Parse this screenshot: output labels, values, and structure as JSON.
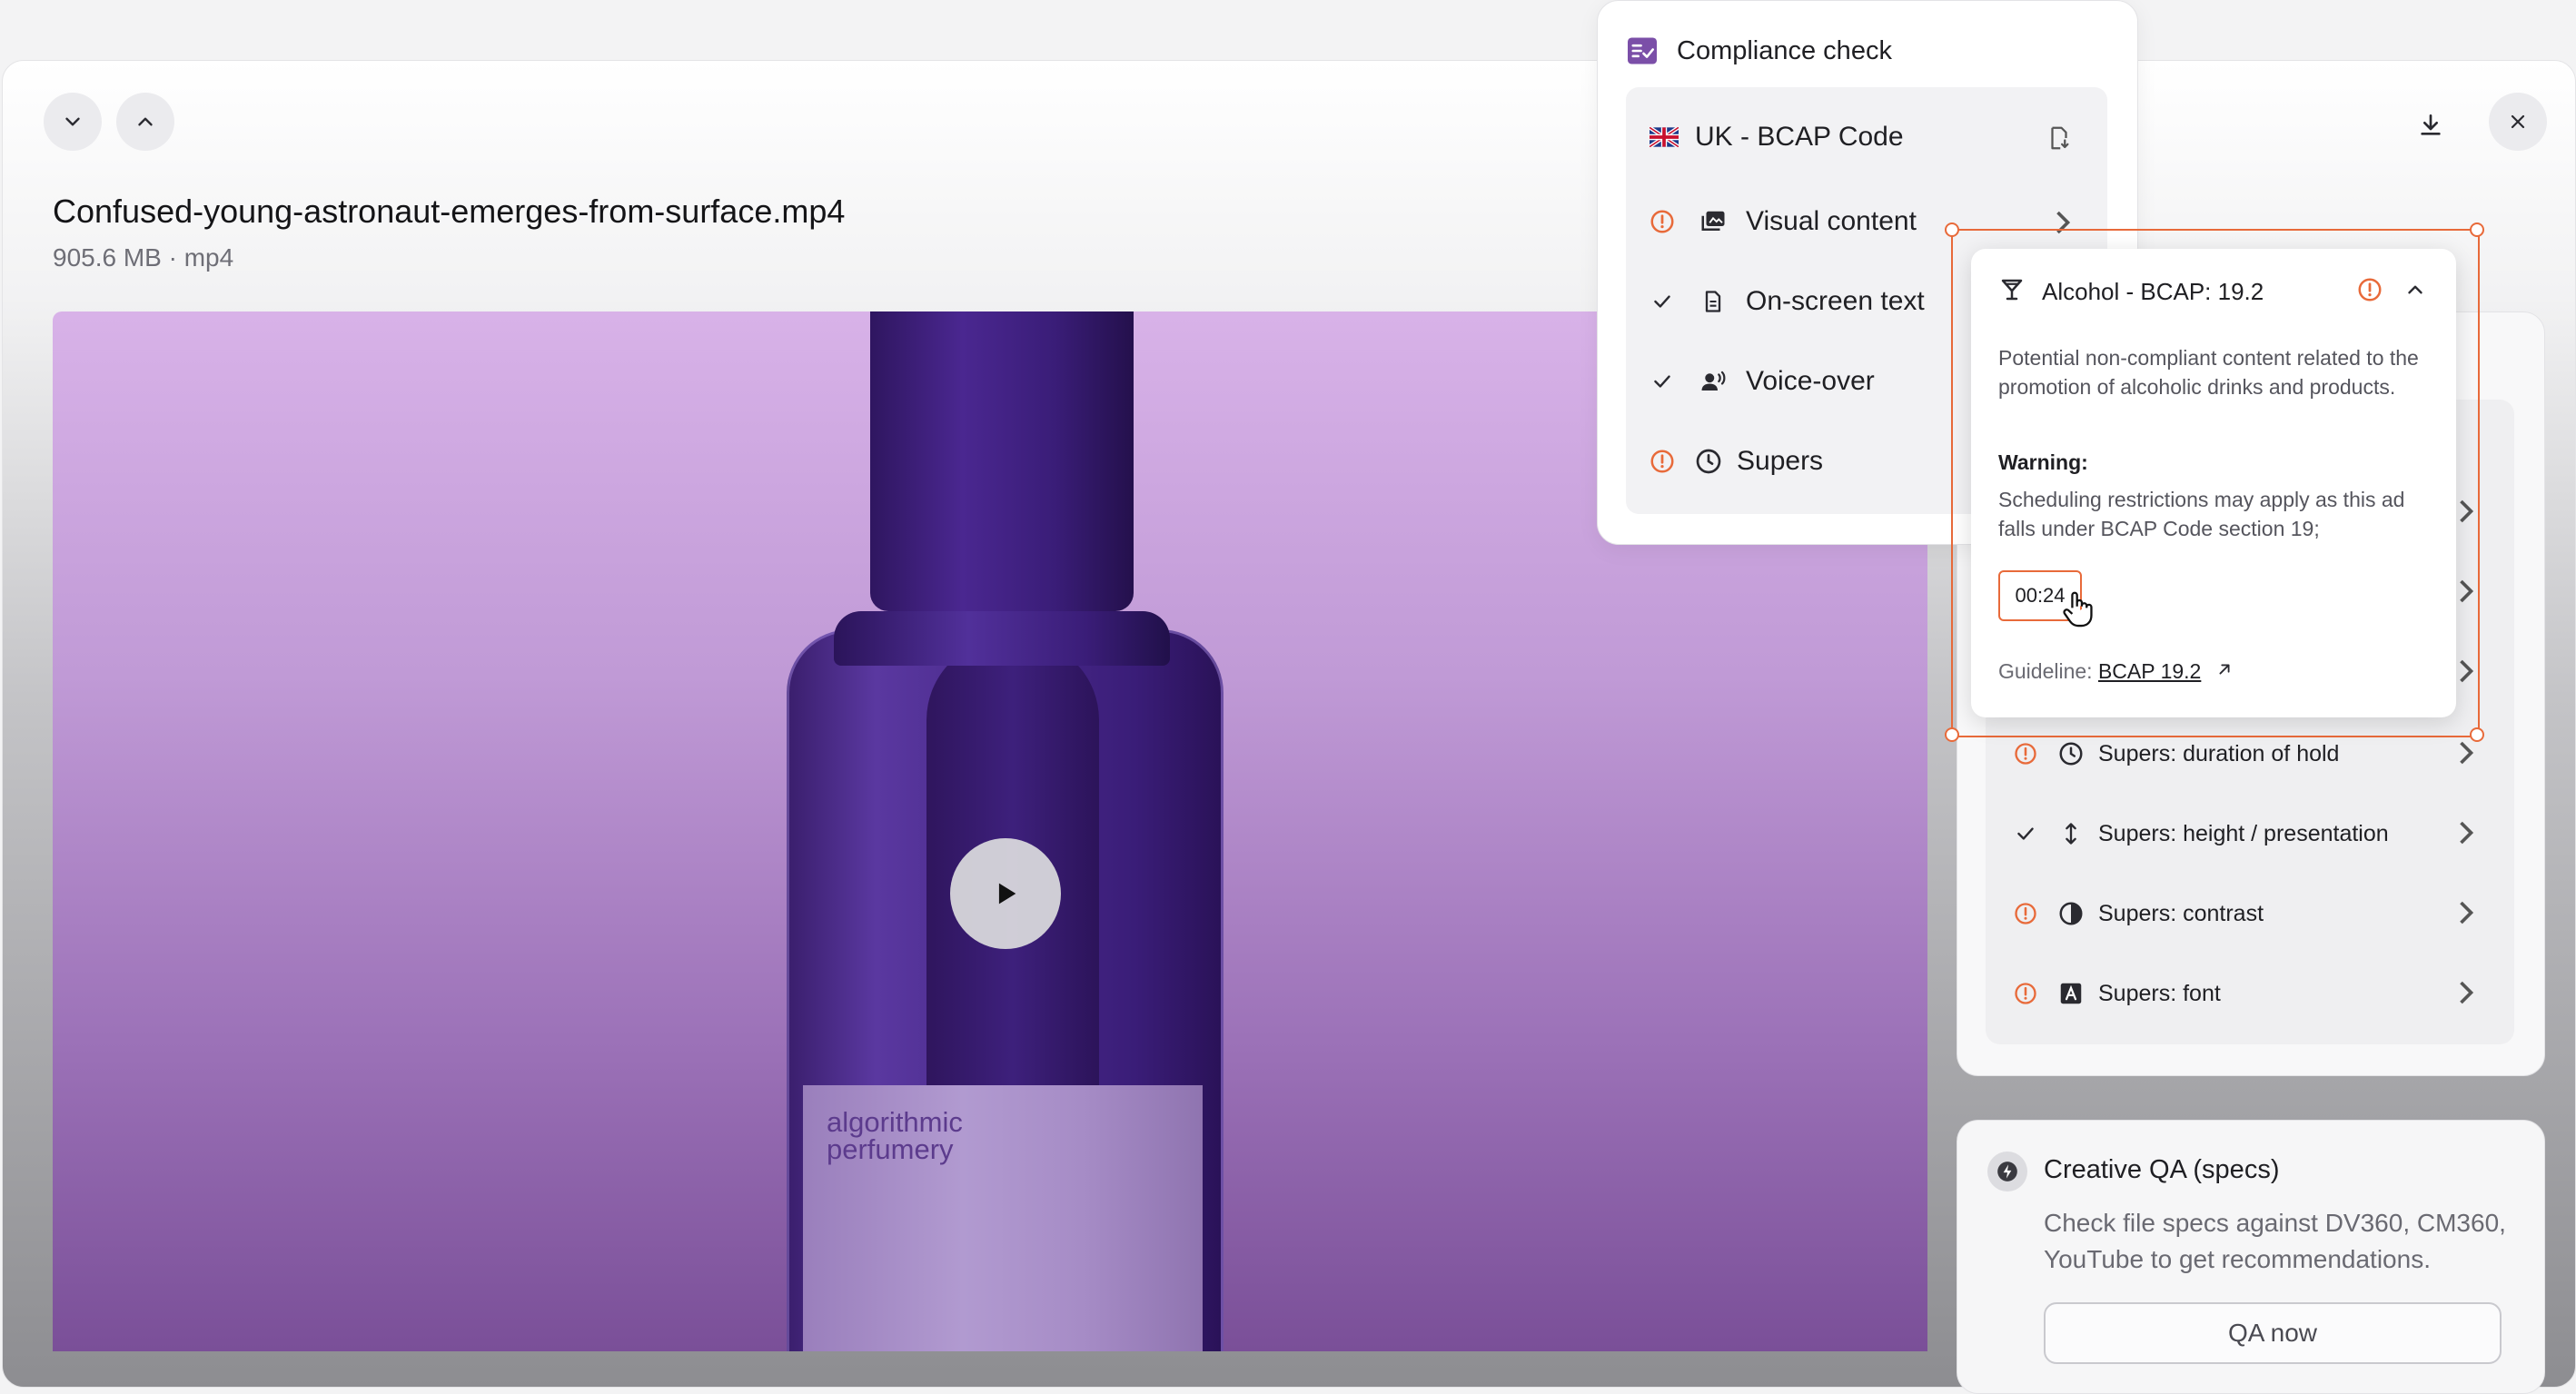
{
  "file": {
    "name": "Confused-young-astronaut-emerges-from-surface.mp4",
    "meta": "905.6 MB · mp4"
  },
  "video": {
    "label_text": "algorithmic\nperfumery"
  },
  "compliance": {
    "title": "Compliance check",
    "code": "UK - BCAP Code",
    "categories": [
      {
        "label": "Visual content",
        "status": "warning"
      },
      {
        "label": "On-screen text",
        "status": "pass"
      },
      {
        "label": "Voice-over",
        "status": "pass"
      },
      {
        "label": "Supers",
        "status": "warning"
      }
    ]
  },
  "popover": {
    "title": "Alcohol - BCAP: 19.2",
    "description": "Potential non-compliant content related to the promotion of alcoholic drinks and products.",
    "warning_label": "Warning:",
    "warning_text": "Scheduling restrictions may apply as this ad falls under BCAP Code section 19;",
    "timestamp": "00:24",
    "guideline_label": "Guideline:",
    "guideline_link": "BCAP 19.2"
  },
  "supers_checks": [
    {
      "label": "Supers: duration of hold",
      "status": "warning",
      "icon": "clock-icon"
    },
    {
      "label": "Supers: height / presentation",
      "status": "pass",
      "icon": "height-arrows-icon"
    },
    {
      "label": "Supers: contrast",
      "status": "warning",
      "icon": "contrast-icon"
    },
    {
      "label": "Supers: font",
      "status": "warning",
      "icon": "font-icon"
    }
  ],
  "creative_qa": {
    "title": "Creative QA (specs)",
    "description": "Check file specs against DV360, CM360, YouTube to get recommendations.",
    "button": "QA now"
  },
  "colors": {
    "warning": "#e86a3a",
    "accent": "#7b4fa8"
  }
}
